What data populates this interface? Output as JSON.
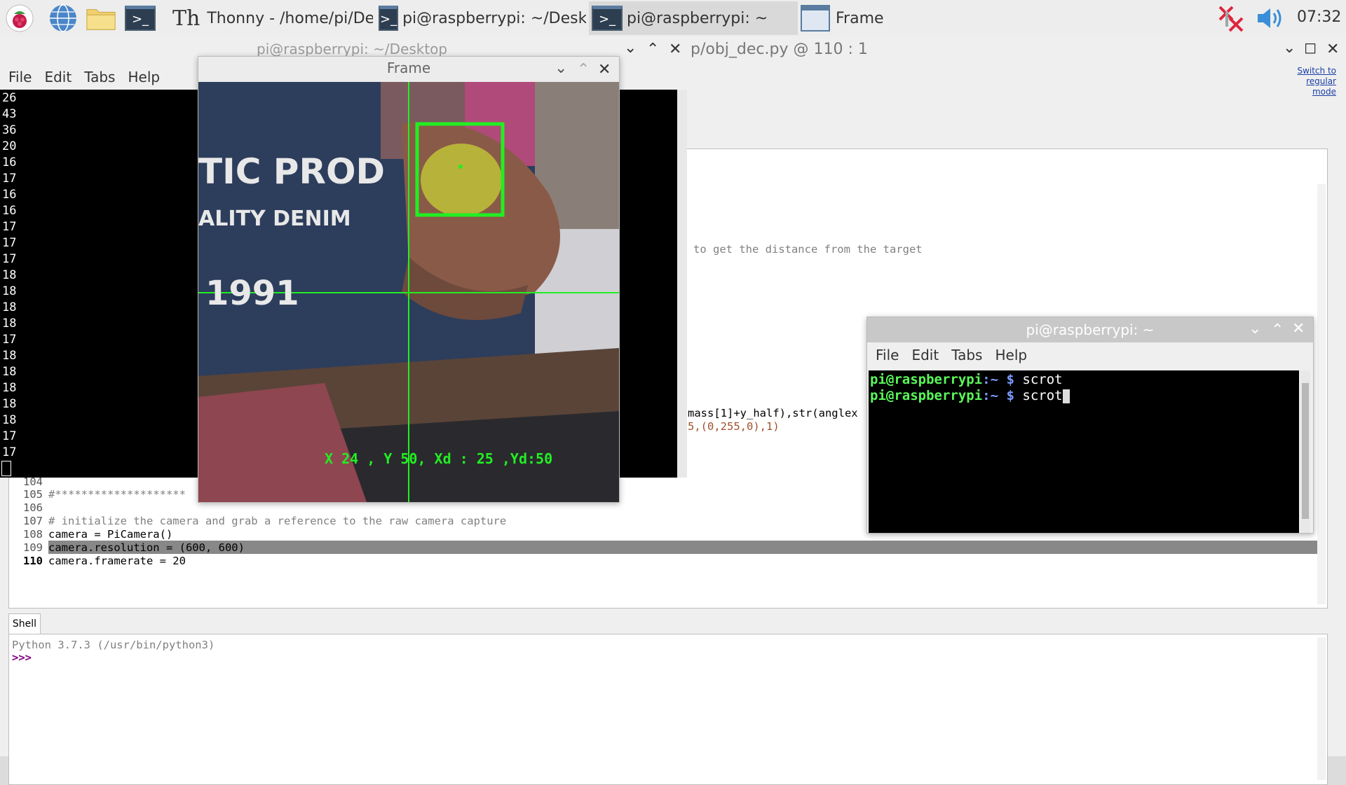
{
  "taskbar": {
    "tasks": [
      {
        "label": "Thonny  -  /home/pi/Des..."
      },
      {
        "label": "pi@raspberrypi: ~/Deskt..."
      },
      {
        "label": "pi@raspberrypi: ~"
      },
      {
        "label": "Frame"
      }
    ],
    "clock": "07:32"
  },
  "thonny": {
    "title_fragment": "p/obj_dec.py  @  110 : 1",
    "switch_link": "Switch to regular mode",
    "editor_lines": [
      {
        "num": "",
        "text": "to get the distance from the target"
      },
      {
        "num": "",
        "text": "mass[1]+y_half),str(anglex"
      },
      {
        "num": "",
        "text": "5,(0,255,0),1)"
      },
      {
        "num": "104",
        "text": ""
      },
      {
        "num": "105",
        "text": "#********************"
      },
      {
        "num": "106",
        "text": ""
      },
      {
        "num": "107",
        "text": "# initialize the camera and grab a reference to the raw camera capture"
      },
      {
        "num": "108",
        "text": "camera = PiCamera()"
      },
      {
        "num": "109",
        "text": "camera.resolution = (600, 600)"
      },
      {
        "num": "110",
        "text": "camera.framerate = 20"
      }
    ],
    "shell_tab": "Shell",
    "shell_banner": "Python 3.7.3 (/usr/bin/python3)",
    "shell_prompt": ">>>"
  },
  "term_desktop": {
    "title": "pi@raspberrypi: ~/Desktop",
    "menu": [
      "File",
      "Edit",
      "Tabs",
      "Help"
    ],
    "numbers": [
      "26",
      "43",
      "36",
      "20",
      "16",
      "17",
      "16",
      "16",
      "17",
      "17",
      "17",
      "18",
      "18",
      "18",
      "18",
      "17",
      "18",
      "18",
      "18",
      "18",
      "18",
      "17",
      "17"
    ]
  },
  "frame_window": {
    "title": "Frame",
    "overlay_text": "X 24 , Y 50, Xd : 25 ,Yd:50",
    "shirt_text_1": "TIC PROD",
    "shirt_text_2": "ALITY DENIM",
    "shirt_text_3": "1991"
  },
  "term_small": {
    "title": "pi@raspberrypi: ~",
    "menu": [
      "File",
      "Edit",
      "Tabs",
      "Help"
    ],
    "lines": [
      {
        "user": "pi@raspberrypi",
        "path": ":~",
        "dollar": "$",
        "cmd": "scrot"
      },
      {
        "user": "pi@raspberrypi",
        "path": ":~",
        "dollar": "$",
        "cmd": "scrot"
      }
    ]
  }
}
